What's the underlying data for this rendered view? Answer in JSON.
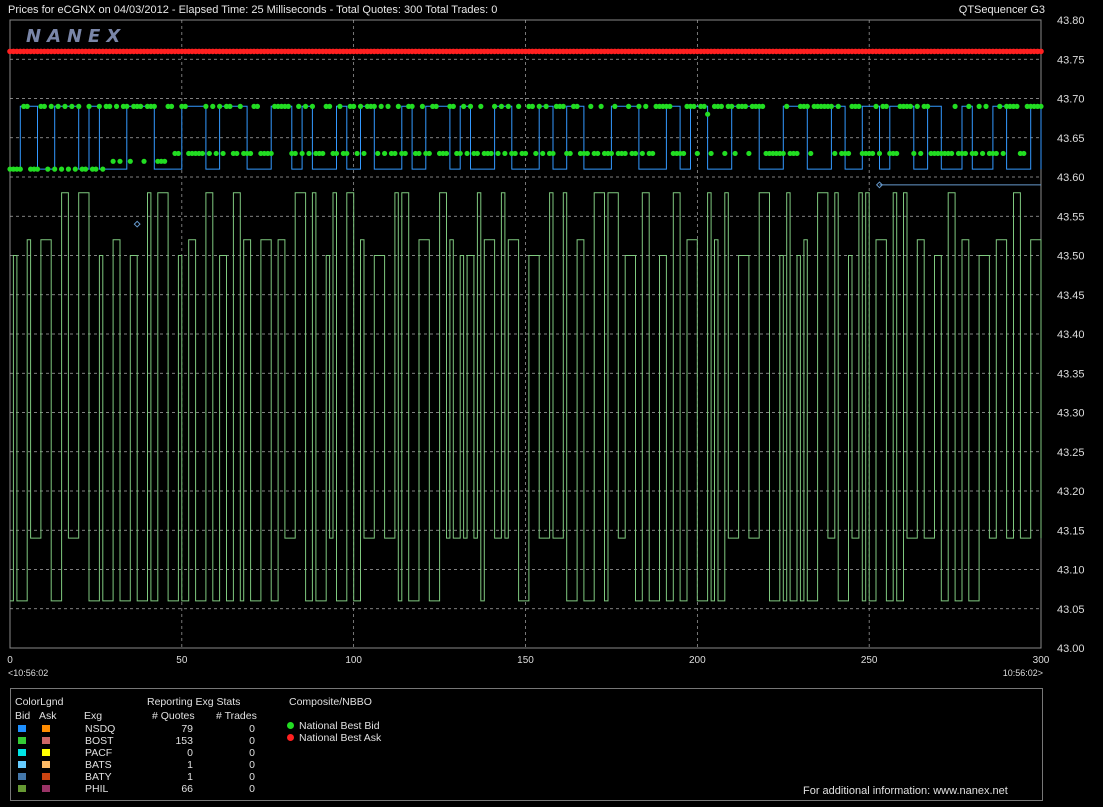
{
  "header": {
    "title": "Prices for  eCGNX  on  04/03/2012  -  Elapsed Time: 25 Milliseconds  -  Total Quotes: 300  Total Trades: 0",
    "app_name": "QTSequencer G3"
  },
  "logo_text": "NANEX",
  "chart_data": {
    "type": "line",
    "title": "Prices for eCGNX on 04/03/2012",
    "xlim": [
      0,
      300
    ],
    "ylim": [
      43.0,
      43.8
    ],
    "x_ticks": [
      0,
      50,
      100,
      150,
      200,
      250,
      300
    ],
    "y_ticks": [
      "43.80",
      "43.75",
      "43.70",
      "43.65",
      "43.60",
      "43.55",
      "43.50",
      "43.45",
      "43.40",
      "43.35",
      "43.30",
      "43.25",
      "43.20",
      "43.15",
      "43.10",
      "43.05",
      "43.00"
    ],
    "x_time_start": "<10:56:02",
    "x_time_end": "10:56:02>",
    "grid": true,
    "series": [
      {
        "name": "National Best Ask",
        "color": "#ff2020",
        "level": 43.76
      },
      {
        "name": "National Best Bid",
        "color": "#22dd22",
        "levels": [
          43.61,
          43.62,
          43.63,
          43.68,
          43.69
        ]
      },
      {
        "name": "BOST",
        "color": "#7fc97f",
        "levels": [
          43.06,
          43.14,
          43.5,
          43.52,
          43.58
        ]
      },
      {
        "name": "NSDQ",
        "color": "#3399ff",
        "levels": [
          43.61,
          43.69
        ]
      },
      {
        "name": "NSDQ Ask",
        "color": "#6699cc",
        "points": [
          [
            37,
            43.54
          ],
          [
            253,
            43.59
          ]
        ]
      }
    ]
  },
  "legend": {
    "section1_title": "ColorLgnd",
    "col_bid": "Bid",
    "col_ask": "Ask",
    "col_exg": "Exg",
    "section2_title": "Reporting Exg Stats",
    "col_quotes": "# Quotes",
    "col_trades": "# Trades",
    "section3_title": "Composite/NBBO",
    "rows": [
      {
        "exg": "NSDQ",
        "quotes": "79",
        "trades": "0",
        "bid_color": "#1e90ff",
        "ask_color": "#ff8c00"
      },
      {
        "exg": "BOST",
        "quotes": "153",
        "trades": "0",
        "bid_color": "#33cc33",
        "ask_color": "#cc6666"
      },
      {
        "exg": "PACF",
        "quotes": "0",
        "trades": "0",
        "bid_color": "#00e5e5",
        "ask_color": "#ffff00"
      },
      {
        "exg": "BATS",
        "quotes": "1",
        "trades": "0",
        "bid_color": "#66ccff",
        "ask_color": "#ffbb66"
      },
      {
        "exg": "BATY",
        "quotes": "1",
        "trades": "0",
        "bid_color": "#4477aa",
        "ask_color": "#cc4411"
      },
      {
        "exg": "PHIL",
        "quotes": "66",
        "trades": "0",
        "bid_color": "#669933",
        "ask_color": "#993366"
      }
    ],
    "nbbo_bid_label": "National Best Bid",
    "nbbo_ask_label": "National Best Ask",
    "nbbo_bid_color": "#22dd22",
    "nbbo_ask_color": "#ff2020",
    "footer": "For additional information: www.nanex.net"
  }
}
